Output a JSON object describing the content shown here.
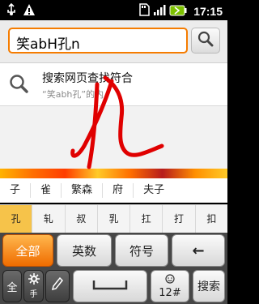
{
  "status": {
    "time": "17:15",
    "icons": [
      "usb-icon",
      "warning-icon",
      "sd-card-icon",
      "signal-icon",
      "battery-icon"
    ]
  },
  "search": {
    "query": "笑abH孔n",
    "button_icon": "search-icon"
  },
  "suggestion": {
    "title": "搜索网页查找符合",
    "subtitle": "“笑abh孔”的内"
  },
  "candidates_row1": [
    "子",
    "雀",
    "繁森",
    "府",
    "夫子"
  ],
  "candidates_row2": [
    "孔",
    "轧",
    "叔",
    "乳",
    "扛",
    "打",
    "扣"
  ],
  "keyboard": {
    "row1": {
      "all": "全部",
      "english": "英数",
      "symbol": "符号",
      "backspace": "←"
    },
    "row2": {
      "full": "全",
      "settings_label": "手",
      "space_label": "",
      "mode_label": "12#",
      "search": "搜索"
    }
  },
  "colors": {
    "accent": "#f57c00",
    "handwriting": "#e00000"
  }
}
